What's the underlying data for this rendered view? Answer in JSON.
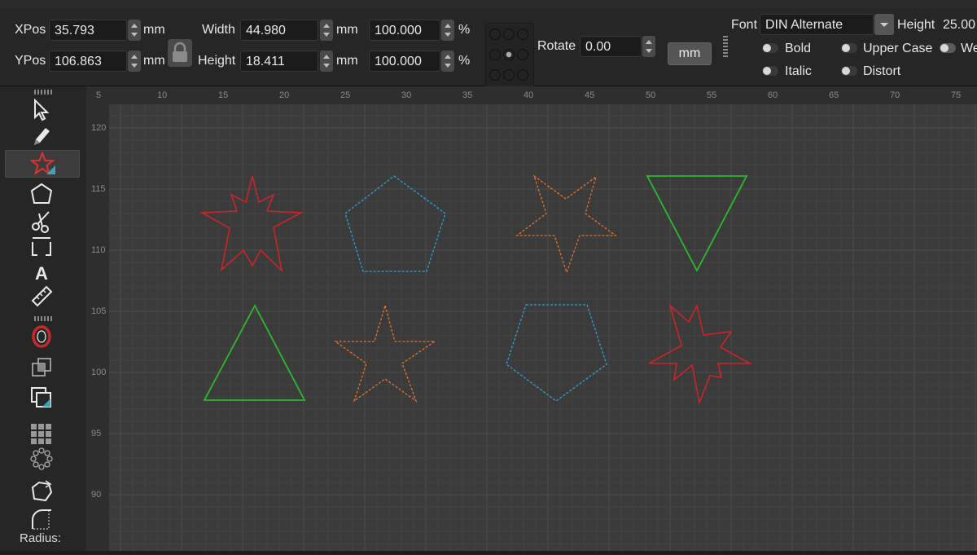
{
  "toolbar": {
    "xpos_label": "XPos",
    "xpos_value": "35.793",
    "ypos_label": "YPos",
    "ypos_value": "106.863",
    "unit_mm": "mm",
    "width_label": "Width",
    "width_value": "44.980",
    "height_label": "Height",
    "height_value": "18.411",
    "scale_w_value": "100.000",
    "scale_h_value": "100.000",
    "percent": "%",
    "rotate_label": "Rotate",
    "rotate_value": "0.00",
    "units_button": "mm",
    "font_label": "Font",
    "font_value": "DIN Alternate",
    "font_height_label": "Height",
    "font_height_value": "25.00",
    "bold_label": "Bold",
    "italic_label": "Italic",
    "upper_case_label": "Upper Case",
    "distort_label": "Distort",
    "welded_label": "We"
  },
  "sidebar": {
    "radius_label": "Radius:",
    "tools": [
      "select-arrow-icon",
      "pencil-icon",
      "star-polygon-icon",
      "polygon-icon",
      "scissors-icon",
      "bracket-icon",
      "text-icon",
      "ruler-icon",
      "offset-icon",
      "boolean-icon",
      "copy-icon",
      "grid-array-icon",
      "circular-array-icon",
      "rotate-node-icon",
      "corner-radius-icon"
    ]
  },
  "ruler": {
    "top": [
      "5",
      "10",
      "15",
      "20",
      "25",
      "30",
      "35",
      "40",
      "45",
      "50",
      "55",
      "60",
      "65",
      "70",
      "75"
    ],
    "left": [
      "120",
      "115",
      "110",
      "105",
      "100",
      "95",
      "90"
    ]
  },
  "colors": {
    "red": "#c9252b",
    "blue": "#2ea1d6",
    "orange": "#e0742f",
    "green": "#2db82d",
    "canvas": "#3b3b3b",
    "grid": "#454545"
  }
}
